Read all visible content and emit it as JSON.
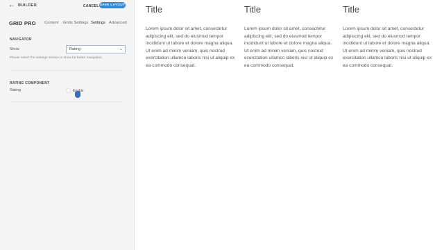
{
  "header": {
    "back_icon": "arrow-left-icon",
    "builder_label": "BUILDER",
    "cancel_label": "CANCEL",
    "save_label": "SAVE LAYOUT",
    "accent": "#2f8bd7"
  },
  "panel": {
    "title": "GRID PRO",
    "tabs": [
      "Content",
      "Grids Settings",
      "Settings",
      "Advanced"
    ],
    "active_tab": "Settings"
  },
  "navigator": {
    "heading": "NAVIGATOR",
    "show_label": "Show",
    "show_value": "Rating",
    "help_text": "Please select the settings section to show for better navigation."
  },
  "rating_component": {
    "heading": "RATING COMPONENT",
    "rating_label": "Rating",
    "enable_label": "Enable"
  },
  "columns": [
    {
      "title": "Title",
      "body": "Lorem ipsum dolor sit amet, consectetur adipiscing elit, sed do eiusmod tempor incididunt ut labore et dolore magna aliqua. Ut enim ad minim veniam, quis nostrud exercitation ullamco laboris nisi ut aliquip ex ea commodo consequat."
    },
    {
      "title": "Title",
      "body": "Lorem ipsum dolor sit amet, consectetur adipiscing elit, sed do eiusmod tempor incididunt ut labore et dolore magna aliqua. Ut enim ad minim veniam, quis nostrud exercitation ullamco laboris nisi ut aliquip ex ea commodo consequat."
    },
    {
      "title": "Title",
      "body": "Lorem ipsum dolor sit amet, consectetur adipiscing elit, sed do eiusmod tempor incididunt ut labore et dolore magna aliqua. Ut enim ad minim veniam, quis nostrud exercitation ullamco laboris nisi ut aliquip ex ea commodo consequat."
    }
  ]
}
